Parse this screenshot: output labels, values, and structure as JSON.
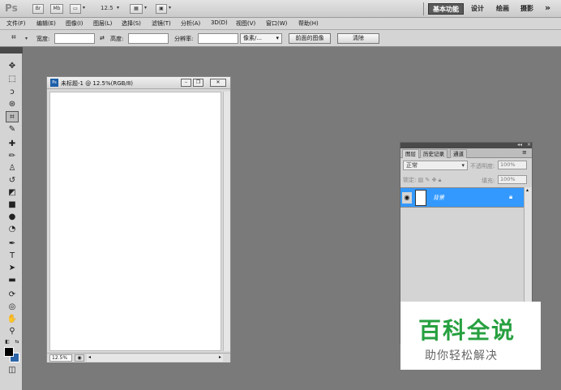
{
  "appbar": {
    "logo": "Ps",
    "bridge_btn": "Br",
    "minibridge_btn": "Mb",
    "zoom": "12.5",
    "workspaces": {
      "basic": "基本功能",
      "design": "设计",
      "paint": "绘画",
      "photo": "摄影",
      "more": "»"
    }
  },
  "menubar": [
    "文件(F)",
    "编辑(E)",
    "图像(I)",
    "图层(L)",
    "选择(S)",
    "滤镜(T)",
    "分析(A)",
    "3D(D)",
    "视图(V)",
    "窗口(W)",
    "帮助(H)"
  ],
  "options": {
    "width_label": "宽度:",
    "height_label": "高度:",
    "resolution_label": "分辨率:",
    "unit": "像素/...",
    "front_image_btn": "前面的图像",
    "clear_btn": "清除"
  },
  "document": {
    "title": "未标题-1 @ 12.5%(RGB/8)",
    "zoom": "12.5%"
  },
  "layers_panel": {
    "tabs": [
      "图层",
      "历史记录",
      "通道"
    ],
    "blend_mode": "正常",
    "opacity_label": "不透明度:",
    "opacity": "100%",
    "lock_label": "锁定:",
    "fill_label": "填充:",
    "fill": "100%",
    "layer_name": "背景"
  },
  "watermark": {
    "title": "百科全说",
    "subtitle": "助你轻松解决"
  }
}
